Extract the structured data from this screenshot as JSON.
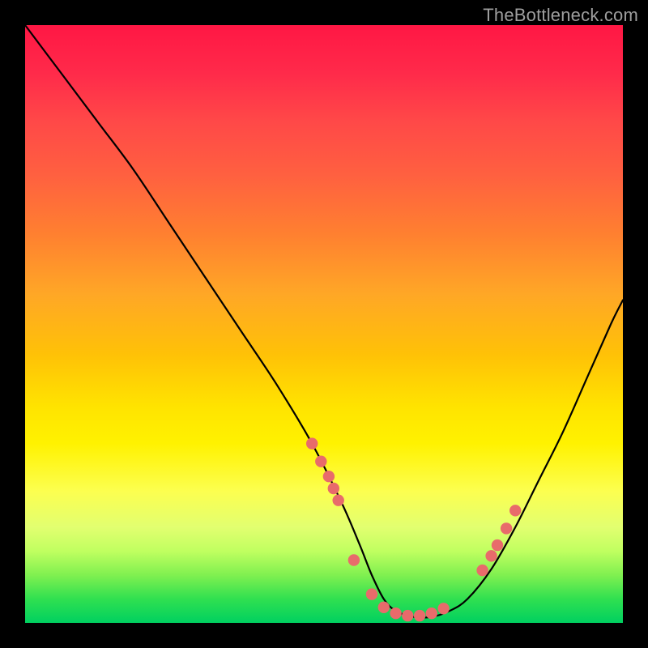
{
  "watermark": "TheBottleneck.com",
  "chart_data": {
    "type": "line",
    "title": "",
    "xlabel": "",
    "ylabel": "",
    "xlim": [
      0,
      100
    ],
    "ylim": [
      0,
      100
    ],
    "series": [
      {
        "name": "curve",
        "x": [
          0,
          6,
          12,
          18,
          24,
          30,
          36,
          42,
          48,
          53,
          56,
          58,
          60,
          62,
          65,
          68,
          71,
          74,
          78,
          82,
          86,
          90,
          94,
          98,
          100
        ],
        "y": [
          100,
          92,
          84,
          76,
          67,
          58,
          49,
          40,
          30,
          20,
          13,
          8,
          4,
          2,
          1,
          1,
          2,
          4,
          9,
          16,
          24,
          32,
          41,
          50,
          54
        ]
      }
    ],
    "markers": {
      "name": "dots",
      "color": "#e86b6b",
      "x": [
        48,
        49.5,
        50.8,
        51.6,
        52.4,
        55,
        58,
        60,
        62,
        64,
        66,
        68,
        70,
        76.5,
        78,
        79,
        80.5,
        82
      ],
      "y": [
        30,
        27,
        24.5,
        22.5,
        20.5,
        10.5,
        4.8,
        2.6,
        1.6,
        1.2,
        1.2,
        1.6,
        2.4,
        8.8,
        11.2,
        13,
        15.8,
        18.8
      ]
    }
  }
}
